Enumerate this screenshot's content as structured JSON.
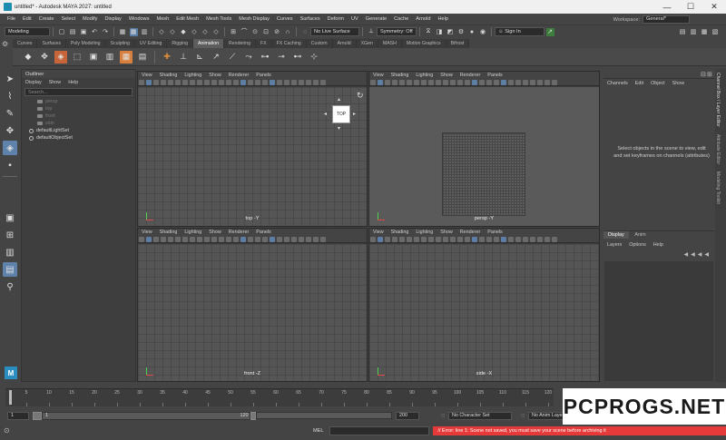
{
  "window": {
    "title": "untitled* - Autodesk MAYA 2027: untitled"
  },
  "menubar": [
    "File",
    "Edit",
    "Create",
    "Select",
    "Modify",
    "Display",
    "Windows",
    "Mesh",
    "Edit Mesh",
    "Mesh Tools",
    "Mesh Display",
    "Curves",
    "Surfaces",
    "Deform",
    "UV",
    "Generate",
    "Cache",
    "Arnold",
    "Help"
  ],
  "workspace": {
    "label": "Workspace:",
    "value": "General*"
  },
  "statusline": {
    "menuset": "Modeling",
    "live_surface": "No Live Surface",
    "symmetry": "Symmetry: Off",
    "sign_in": "Sign In"
  },
  "shelf_tabs": [
    "Curves",
    "Surfaces",
    "Poly Modeling",
    "Sculpting",
    "UV Editing",
    "Rigging",
    "Animation",
    "Rendering",
    "FX",
    "FX Caching",
    "Custom",
    "Arnold",
    "XGen",
    "MASH",
    "Motion Graphics",
    "Bifrost"
  ],
  "shelf_active": "Animation",
  "outliner": {
    "title": "Outliner",
    "menu": [
      "Display",
      "Show",
      "Help"
    ],
    "search_placeholder": "Search...",
    "items": [
      {
        "label": "persp",
        "kind": "camera",
        "dim": true
      },
      {
        "label": "top",
        "kind": "camera",
        "dim": true
      },
      {
        "label": "front",
        "kind": "camera",
        "dim": true
      },
      {
        "label": "side",
        "kind": "camera",
        "dim": true
      },
      {
        "label": "defaultLightSet",
        "kind": "set",
        "dim": false
      },
      {
        "label": "defaultObjectSet",
        "kind": "set",
        "dim": false
      }
    ]
  },
  "viewport_menu": [
    "View",
    "Shading",
    "Lighting",
    "Show",
    "Renderer",
    "Panels"
  ],
  "viewports": {
    "top": "top -Y",
    "persp": "persp -Y",
    "front": "front -Z",
    "side": "side -X"
  },
  "viewcube_label": "TOP",
  "channelbox": {
    "menu": [
      "Channels",
      "Edit",
      "Object",
      "Show"
    ],
    "message": "Select objects in the scene to view, edit and set keyframes on channels (attributes)"
  },
  "layereditor": {
    "tabs": [
      "Display",
      "Anim"
    ],
    "menu": [
      "Layers",
      "Options",
      "Help"
    ]
  },
  "side_tabs": [
    "Channel Box / Layer Editor",
    "Attribute Editor",
    "Modeling Toolkit"
  ],
  "timeline": {
    "ticks": [
      "5",
      "10",
      "15",
      "20",
      "25",
      "30",
      "35",
      "40",
      "45",
      "50",
      "55",
      "60",
      "65",
      "70",
      "75",
      "80",
      "85",
      "90",
      "95",
      "100",
      "105",
      "110",
      "115",
      "120"
    ],
    "start": "1",
    "range_start": "1",
    "range_end_marker": "120",
    "end": "200"
  },
  "range_bar": {
    "character_set": "No Character Set",
    "anim_layer": "No Anim Layer"
  },
  "cmdline": {
    "label": "MEL",
    "error": "// Error: line 1: Scene not saved, you must save your scene before archiving it"
  },
  "watermark": "PCPROGS.NET"
}
